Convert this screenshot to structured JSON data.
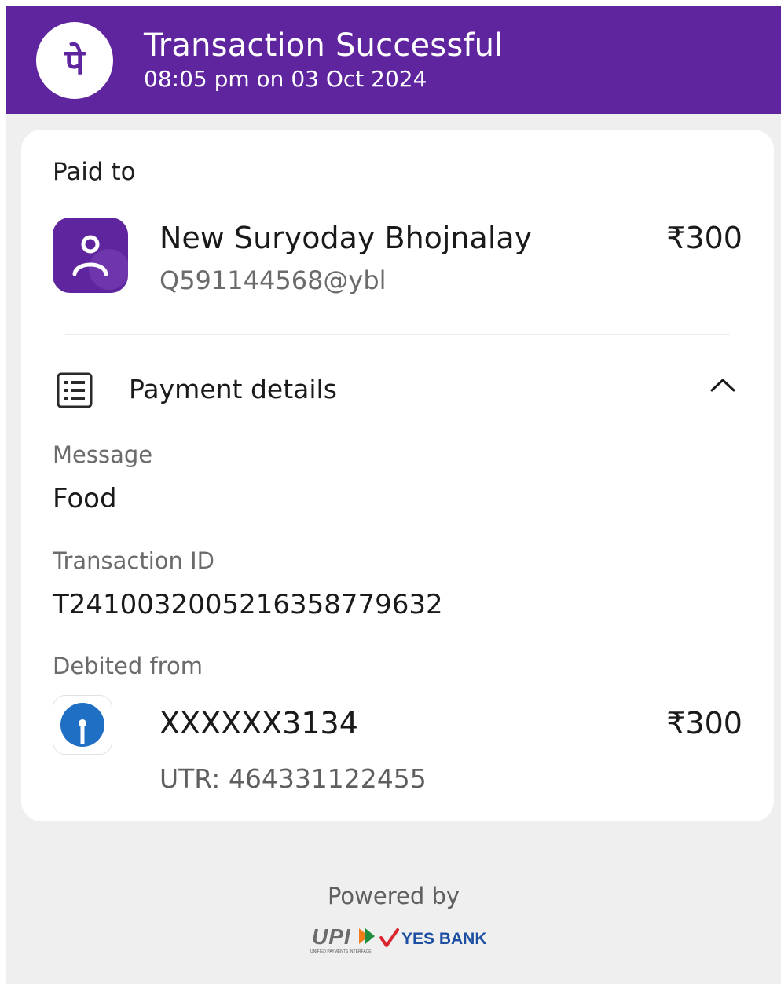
{
  "header": {
    "logo_glyph": "पे",
    "title": "Transaction Successful",
    "datetime": "08:05 pm on 03 Oct 2024",
    "bg_color": "#5f259f"
  },
  "paid_to": {
    "heading": "Paid to",
    "avatar_icon": "person-icon",
    "name": "New Suryoday Bhojnalay",
    "upi_id": "Q591144568@ybl",
    "amount": "₹300"
  },
  "payment_details": {
    "title": "Payment details",
    "icon": "receipt-list-icon",
    "toggle_icon": "chevron-up-icon",
    "fields": [
      {
        "label": "Message",
        "value": "Food"
      },
      {
        "label": "Transaction ID",
        "value": "T2410032005216358779632"
      }
    ],
    "debited_from": {
      "label": "Debited from",
      "bank_icon": "sbi-bank-logo-icon",
      "account": "XXXXXX3134",
      "amount": "₹300",
      "utr": "UTR: 464331122455"
    }
  },
  "footer": {
    "powered_by": "Powered by",
    "upi_logo_text": "UPI",
    "upi_tagline": "UNIFIED PAYMENTS INTERFACE",
    "partner": "YES BANK"
  }
}
